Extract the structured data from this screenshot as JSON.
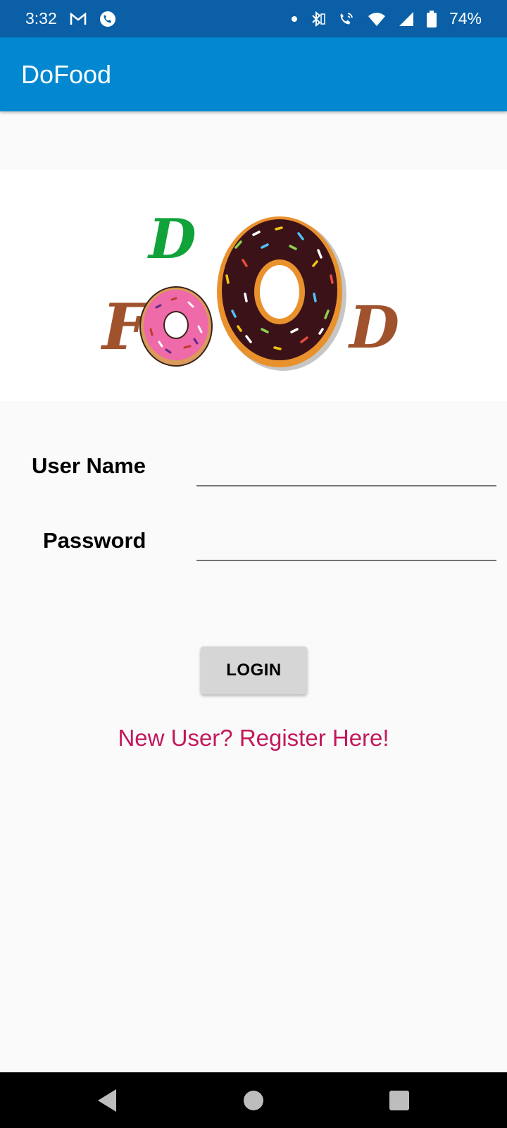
{
  "status_bar": {
    "time": "3:32",
    "battery": "74%",
    "left_icons": [
      "gmail-icon",
      "phone-call-icon"
    ],
    "right_icons": [
      "dot-icon",
      "bluetooth-icon",
      "wifi-calling-icon",
      "wifi-icon",
      "signal-icon",
      "battery-icon"
    ]
  },
  "app_bar": {
    "title": "DoFood"
  },
  "logo": {
    "letters": {
      "d_top": "D",
      "f_left": "F",
      "d_right": "D"
    },
    "colors": {
      "green": "#11a33a",
      "brown": "#a0522d",
      "pink": "#ef6aa8",
      "chocolate": "#3b1218",
      "dough": "#e8912d"
    }
  },
  "form": {
    "username_label": "User Name",
    "username_value": "",
    "password_label": "Password",
    "password_value": ""
  },
  "login_button": "LOGIN",
  "register_link": "New User? Register Here!",
  "colors": {
    "app_bar": "#0288d1",
    "status_bar": "#0a5fa6",
    "accent_link": "#c2185b",
    "button_bg": "#d6d6d6"
  },
  "nav_bar": {
    "icons": [
      "back-icon",
      "home-icon",
      "recents-icon"
    ]
  }
}
